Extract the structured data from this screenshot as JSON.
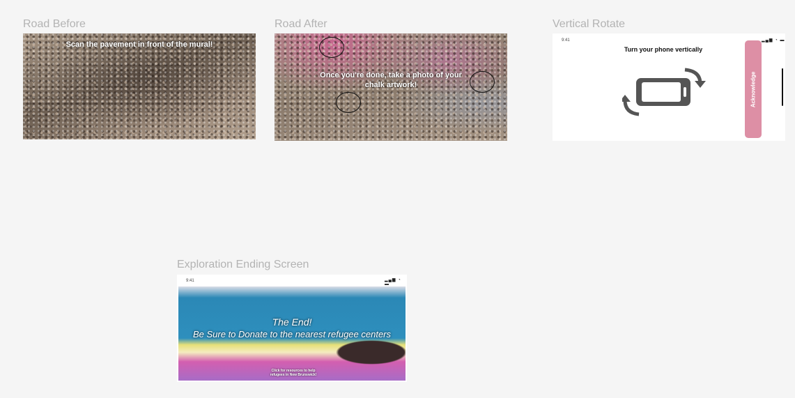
{
  "frames": {
    "road_before": {
      "label": "Road Before",
      "message": "Scan the pavement in front of the mural!"
    },
    "road_after": {
      "label": "Road After",
      "message": "Once you're done, take a photo of your chalk artwork!"
    },
    "vertical_rotate": {
      "label": "Vertical Rotate",
      "status_time": "9:41",
      "status_icons": "▂▄▆ ◔ ▬",
      "title": "Turn your phone vertically",
      "button_label": "Acknowledge",
      "button_color": "#dd8fa5"
    },
    "ending": {
      "label": "Exploration Ending Screen",
      "status_time": "9:41",
      "status_icons": "▂▄▆ ◔ ▬",
      "headline": "The End!",
      "subline": "Be Sure to Donate to the nearest refugee centers",
      "link_text": "Click for resources to help refugees in New Brunswick!"
    }
  },
  "colors": {
    "canvas": "#f5f5f5",
    "label": "#b3b3b3",
    "accent_pink": "#dd8fa5"
  }
}
